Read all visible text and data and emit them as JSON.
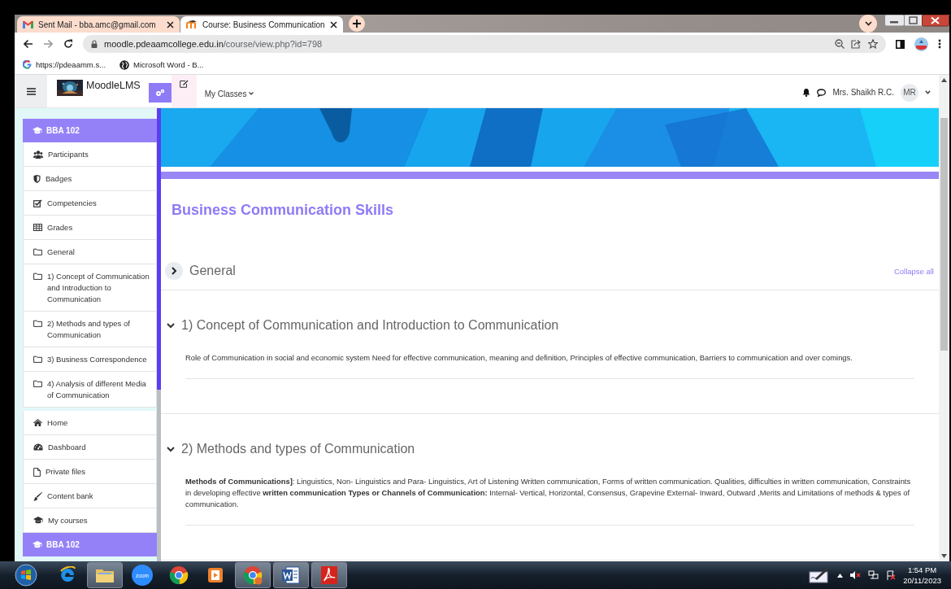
{
  "browser": {
    "tabs": [
      {
        "title": "Sent Mail - bba.amc@gmail.com",
        "selected": false
      },
      {
        "title": "Course: Business Communication",
        "selected": true
      }
    ],
    "address": {
      "host": "moodle.pdeaamcollege.edu.in",
      "path": "/course/view.php?id=798"
    },
    "bookmarks": [
      "https://pdeaamm.s...",
      "Microsoft Word - B..."
    ]
  },
  "navbar": {
    "brand": "MoodleLMS",
    "menu": "My Classes",
    "user": "Mrs. Shaikh R.C.",
    "avatar": "MR"
  },
  "sidebar": {
    "course": "BBA 102",
    "course_items": [
      "Participants",
      "Badges",
      "Competencies",
      "Grades",
      "General",
      "1) Concept of Communication and Introduction to Communication",
      "2) Methods and types of Communication",
      "3) Business Correspondence",
      "4) Analysis of different Media of Communication"
    ],
    "site_items": [
      "Home",
      "Dashboard",
      "Private files",
      "Content bank",
      "My courses"
    ],
    "next_course": "BBA 102"
  },
  "main": {
    "title": "Business Communication Skills",
    "collapse_all": "Collapse all",
    "sections": [
      {
        "title": "General",
        "expanded": false
      },
      {
        "title": "1) Concept of Communication and Introduction to Communication",
        "expanded": true,
        "summary": "Role of Communication in social and economic system Need for effective communication, meaning and definition, Principles of effective communication, Barriers to communication and over comings."
      },
      {
        "title": "2) Methods and types of Communication",
        "expanded": true,
        "summary": "**Methods of Communications]**: Linguistics, Non- Linguistics and Para- Linguistics, Art of Listening Written communication, Forms of written communication. Qualities, difficulties in written communication, Constraints in developing effective **written communication Types or Channels of Communication:** Internal- Vertical, Horizontal, Consensus, Grapevine External- Inward, Outward ,Merits and Limitations of methods & types of communication."
      }
    ]
  },
  "taskbar": {
    "zoom_label": "zoom",
    "time": "1:54 PM",
    "date": "20/11/2023"
  }
}
